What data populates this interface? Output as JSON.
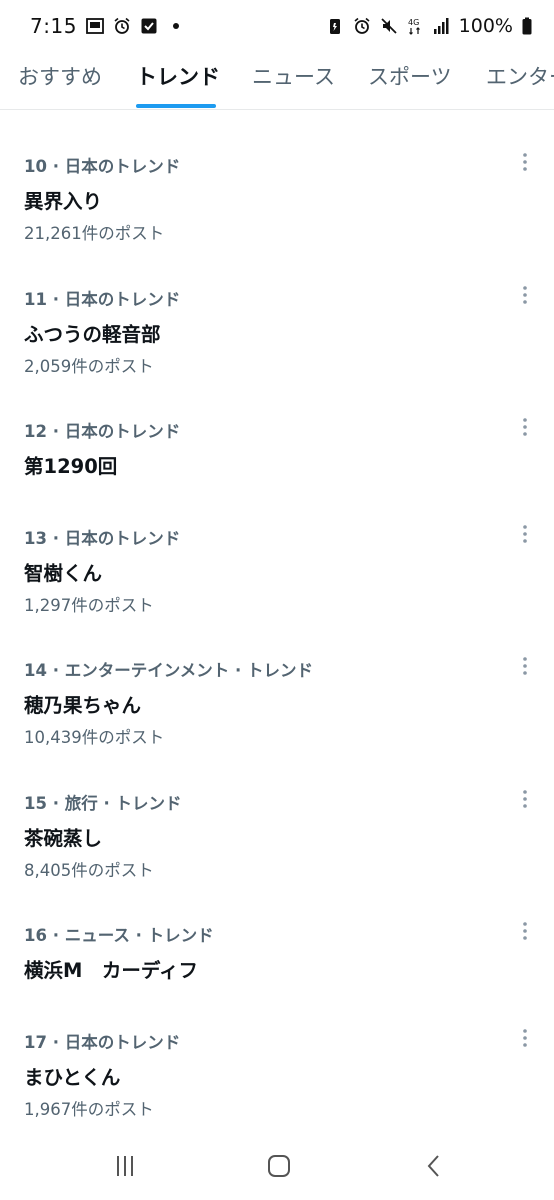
{
  "status_bar": {
    "time": "7:15",
    "network": "4G",
    "battery": "100%"
  },
  "tabs": [
    {
      "label": "おすすめ",
      "active": false
    },
    {
      "label": "トレンド",
      "active": true
    },
    {
      "label": "ニュース",
      "active": false
    },
    {
      "label": "スポーツ",
      "active": false
    },
    {
      "label": "エンター",
      "active": false
    }
  ],
  "trends": [
    {
      "meta": "10 · 日本のトレンド",
      "title": "異界入り",
      "posts": "21,261件のポスト"
    },
    {
      "meta": "11 · 日本のトレンド",
      "title": "ふつうの軽音部",
      "posts": "2,059件のポスト"
    },
    {
      "meta": "12 · 日本のトレンド",
      "title": "第1290回",
      "posts": ""
    },
    {
      "meta": "13 · 日本のトレンド",
      "title": "智樹くん",
      "posts": "1,297件のポスト"
    },
    {
      "meta": "14 · エンターテインメント · トレンド",
      "title": "穂乃果ちゃん",
      "posts": "10,439件のポスト"
    },
    {
      "meta": "15 · 旅行 · トレンド",
      "title": "茶碗蒸し",
      "posts": "8,405件のポスト"
    },
    {
      "meta": "16 · ニュース · トレンド",
      "title": "横浜M　カーディフ",
      "posts": ""
    },
    {
      "meta": "17 · 日本のトレンド",
      "title": "まひとくん",
      "posts": "1,967件のポスト"
    }
  ],
  "icons": {
    "more": "more-vertical-icon",
    "recents": "recent-apps-icon",
    "home": "home-icon",
    "back": "back-icon"
  },
  "colors": {
    "accent": "#1d9bf0",
    "text_primary": "#0f1419",
    "text_secondary": "#536471"
  }
}
